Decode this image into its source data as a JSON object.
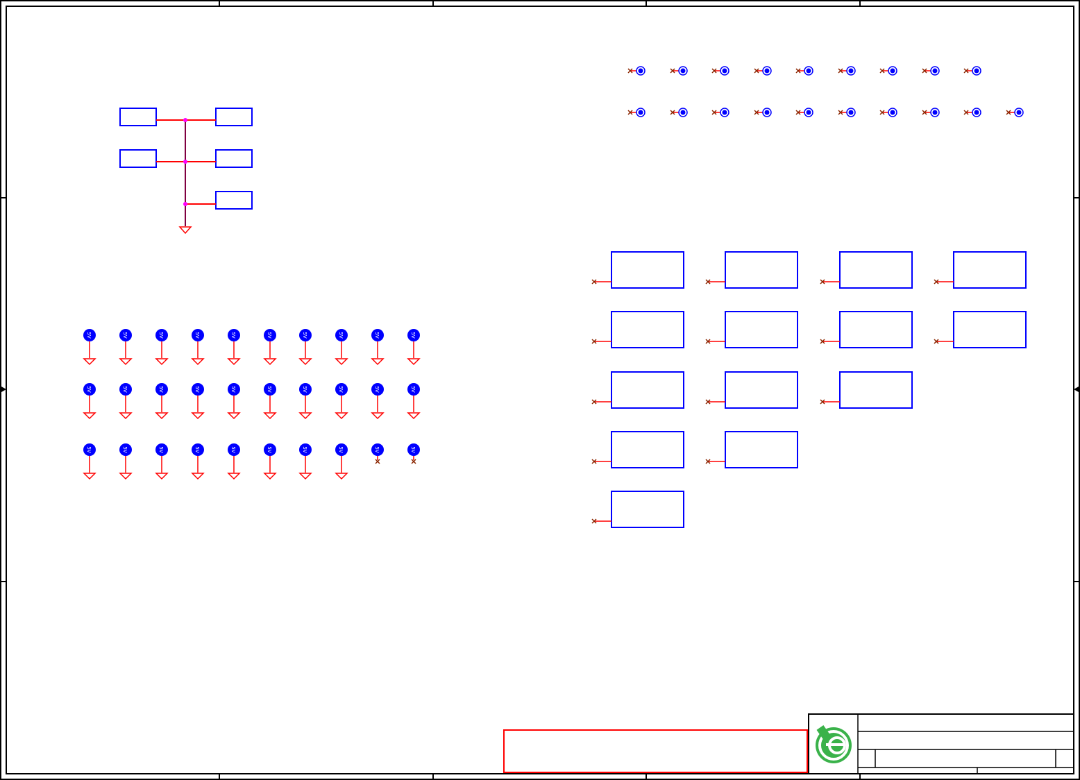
{
  "schematic": {
    "zones": {
      "columns": 5,
      "rows": 4
    },
    "pin_label": "5V",
    "colors": {
      "frame": "#000000",
      "part_outline": "#0000ff",
      "wire": "#ff0000",
      "bus": "#800040",
      "junction": "#ff00ff",
      "no_connect": "#8b2500",
      "ground": "#ff0000",
      "pin_fill": "#0000ff",
      "notes_box": "#ff0000",
      "logo": "#3ab24a"
    },
    "icons": {
      "ground": "ground-symbol-icon",
      "junction": "junction-dot-icon",
      "no_connect": "no-connect-x-icon",
      "test_point": "test-point-icon",
      "logo": "easyeda-logo-icon"
    },
    "title_block": {
      "title": "",
      "company": "",
      "sheet": "",
      "rev": ""
    },
    "notes": ""
  }
}
